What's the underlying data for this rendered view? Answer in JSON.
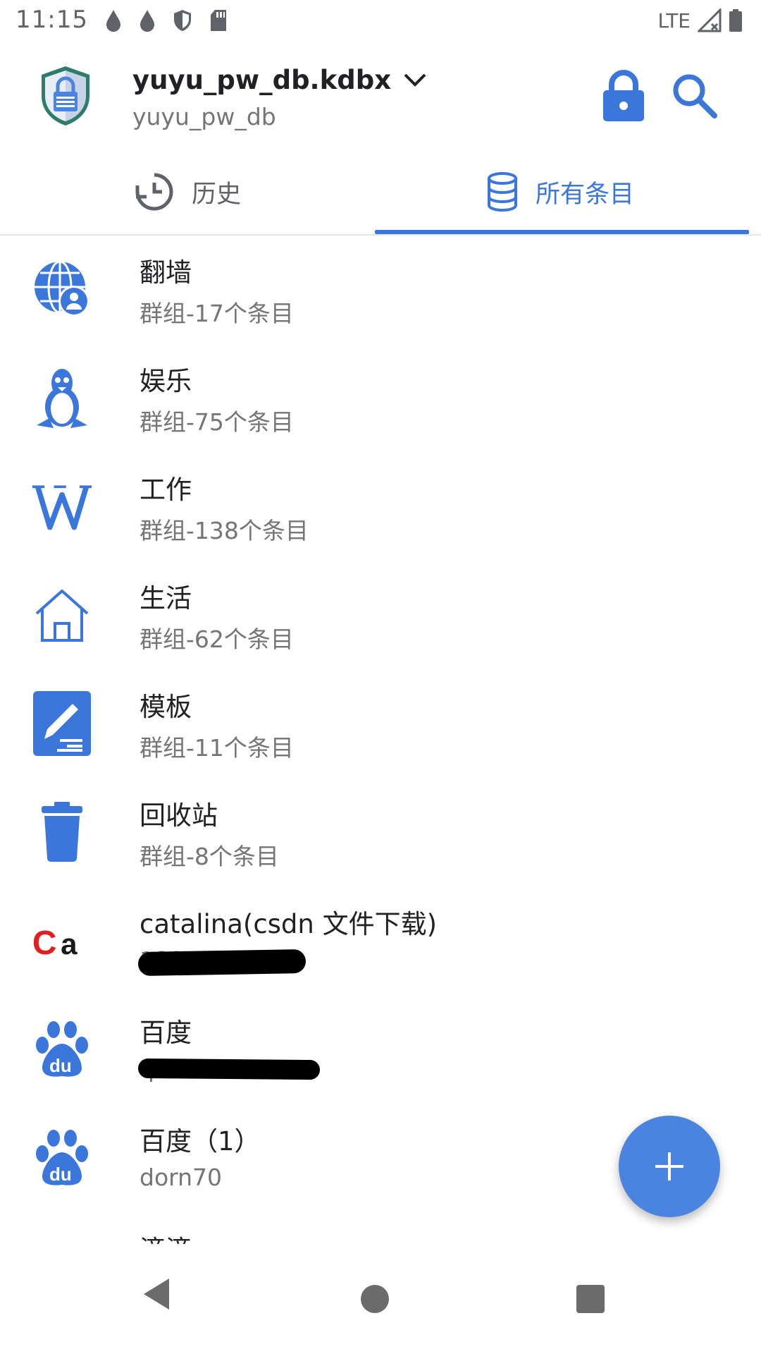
{
  "status_bar": {
    "time": "11:15",
    "network": "LTE",
    "left_icons": [
      "drop-icon",
      "drop-icon",
      "shield-icon",
      "sd-card-icon"
    ],
    "right_icons": [
      "signal-icon",
      "battery-icon"
    ]
  },
  "toolbar": {
    "db_name": "yuyu_pw_db.kdbx",
    "db_subtitle": "yuyu_pw_db",
    "logo": "keepass-shield-icon",
    "actions": [
      "lock-icon",
      "search-icon"
    ]
  },
  "tabs": [
    {
      "label": "历史",
      "icon": "history-clock-icon",
      "selected": false
    },
    {
      "label": "所有条目",
      "icon": "database-icon",
      "selected": true
    }
  ],
  "list": [
    {
      "title": "翻墙",
      "subtitle": "群组-17个条目",
      "icon": "globe-user-icon"
    },
    {
      "title": "娱乐",
      "subtitle": "群组-75个条目",
      "icon": "penguin-icon"
    },
    {
      "title": "工作",
      "subtitle": "群组-138个条目",
      "icon": "wikipedia-w-icon"
    },
    {
      "title": "生活",
      "subtitle": "群组-62个条目",
      "icon": "home-icon"
    },
    {
      "title": "模板",
      "subtitle": "群组-11个条目",
      "icon": "edit-document-icon"
    },
    {
      "title": "回收站",
      "subtitle": "群组-8个条目",
      "icon": "trash-icon"
    },
    {
      "title": "catalina(csdn 文件下载)",
      "subtitle": "1805",
      "icon": "ca-logo-icon",
      "redacted": true
    },
    {
      "title": "百度",
      "subtitle": "qi",
      "icon": "baidu-paw-icon",
      "redacted": true
    },
    {
      "title": "百度（1）",
      "subtitle": "dorn70",
      "icon": "baidu-paw-icon"
    },
    {
      "title": "滴滴",
      "subtitle": "",
      "icon": "didi-icon"
    }
  ],
  "fab": {
    "icon": "plus-icon"
  },
  "colors": {
    "accent": "#3b77db",
    "fab": "#4a84e0",
    "text_secondary": "#757575"
  }
}
